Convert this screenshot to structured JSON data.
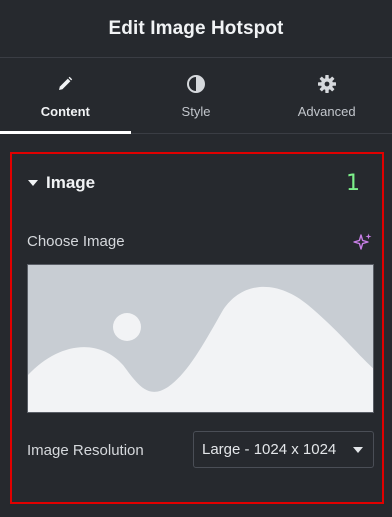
{
  "header": {
    "title": "Edit Image Hotspot"
  },
  "tabs": [
    {
      "label": "Content",
      "icon": "pencil-icon",
      "active": true
    },
    {
      "label": "Style",
      "icon": "contrast-icon",
      "active": false
    },
    {
      "label": "Advanced",
      "icon": "gear-icon",
      "active": false
    }
  ],
  "section": {
    "title": "Image",
    "marker": "1",
    "choose_label": "Choose Image",
    "resolution_label": "Image Resolution",
    "resolution_value": "Large - 1024 x 1024"
  },
  "colors": {
    "accent_marker": "#7df08a",
    "highlight_border": "#e00000",
    "ai_icon": "#c77ee6"
  }
}
